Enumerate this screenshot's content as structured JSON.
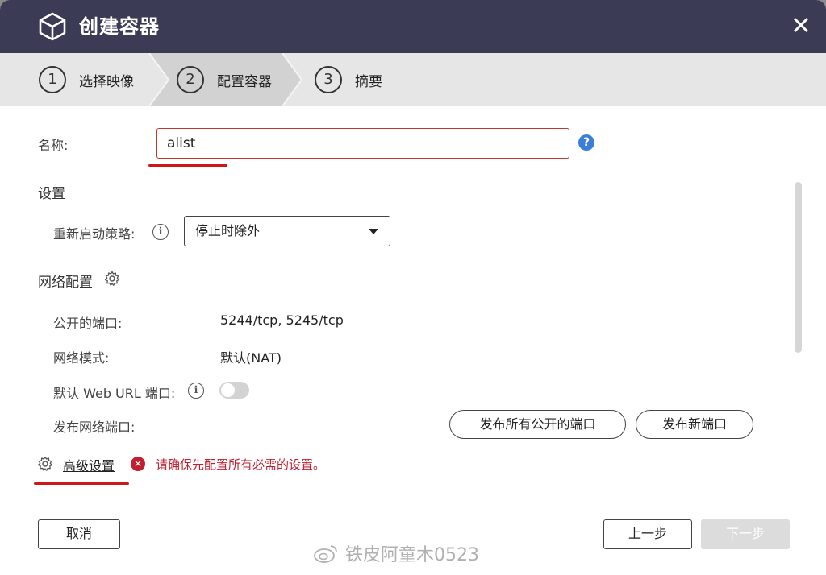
{
  "window": {
    "title": "创建容器",
    "close_label": "✕"
  },
  "steps": [
    {
      "num": "1",
      "label": "选择映像"
    },
    {
      "num": "2",
      "label": "配置容器"
    },
    {
      "num": "3",
      "label": "摘要"
    }
  ],
  "form": {
    "name_label": "名称:",
    "name_value": "alist",
    "help_label": "?",
    "settings_title": "设置",
    "restart_label": "重新启动策略:",
    "restart_value": "停止时除外",
    "network_title": "网络配置",
    "published_ports_label": "公开的端口:",
    "published_ports_value": "5244/tcp, 5245/tcp",
    "network_mode_label": "网络模式:",
    "network_mode_value": "默认(NAT)",
    "web_url_label": "默认 Web URL 端口:",
    "publish_ports_label": "发布网络端口:",
    "publish_all_button": "发布所有公开的端口",
    "publish_new_button": "发布新端口",
    "info_glyph": "i"
  },
  "advanced": {
    "link_label": "高级设置",
    "error_icon": "✕",
    "error_text": "请确保先配置所有必需的设置。"
  },
  "footer": {
    "cancel": "取消",
    "prev": "上一步",
    "next": "下一步"
  },
  "watermark": "铁皮阿童木0523",
  "colors": {
    "titlebar": "#3c3b55",
    "error": "#c01f2f",
    "help": "#3b7ed8"
  }
}
